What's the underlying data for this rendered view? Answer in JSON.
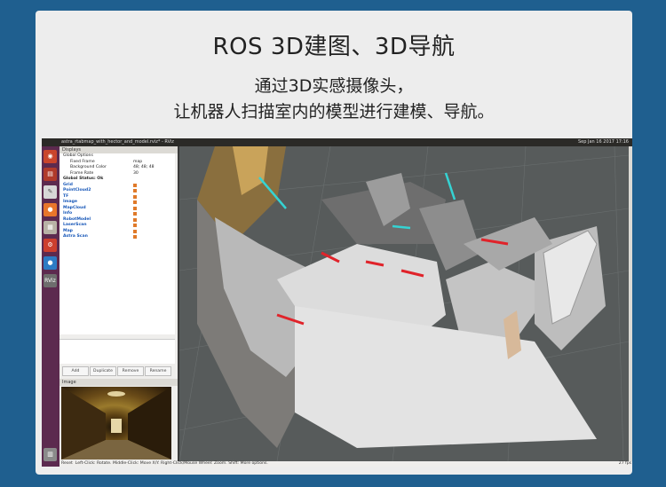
{
  "header": {
    "title": "ROS 3D建图、3D导航",
    "line1": "通过3D实感摄像头，",
    "line2": "让机器人扫描室内的模型进行建模、导航。"
  },
  "window": {
    "title": "astra_rtabmap_with_hector_and_model.rviz* - RViz",
    "clock": "Sep Jan 16 2017 17:16"
  },
  "displays": {
    "panel_title": "Displays",
    "rows": [
      {
        "key": "Global Options",
        "value": "",
        "style": "normal",
        "check": false
      },
      {
        "key": "Fixed Frame",
        "value": "map",
        "style": "normal",
        "check": false
      },
      {
        "key": "Background Color",
        "value": "48; 48; 48",
        "style": "normal",
        "check": false
      },
      {
        "key": "Frame Rate",
        "value": "30",
        "style": "normal",
        "check": false
      },
      {
        "key": "Global Status: Ok",
        "value": "",
        "style": "bold",
        "check": false
      },
      {
        "key": "Grid",
        "value": "",
        "style": "blue",
        "check": true
      },
      {
        "key": "PointCloud2",
        "value": "",
        "style": "blue",
        "check": true
      },
      {
        "key": "TF",
        "value": "",
        "style": "blue",
        "check": true
      },
      {
        "key": "Image",
        "value": "",
        "style": "blue",
        "check": true
      },
      {
        "key": "MapCloud",
        "value": "",
        "style": "blue",
        "check": true
      },
      {
        "key": "Info",
        "value": "",
        "style": "blue",
        "check": true
      },
      {
        "key": "RobotModel",
        "value": "",
        "style": "blue",
        "check": true
      },
      {
        "key": "LaserScan",
        "value": "",
        "style": "blue",
        "check": true
      },
      {
        "key": "Map",
        "value": "",
        "style": "blue",
        "check": true
      },
      {
        "key": "Astra Scan",
        "value": "",
        "style": "blue",
        "check": true
      }
    ],
    "buttons": {
      "add": "Add",
      "duplicate": "Duplicate",
      "remove": "Remove",
      "rename": "Rename"
    },
    "image_panel_title": "Image"
  },
  "status": {
    "reset": "Reset",
    "hint": "Left-Click: Rotate. Middle-Click: Move X/Y. Right-Click/Mouse Wheel: Zoom. Shift: More options.",
    "fps": "27 fps"
  },
  "launcher_icons": [
    "ubuntu-icon",
    "terminal-icon",
    "text-editor-icon",
    "firefox-icon",
    "files-icon",
    "settings-icon",
    "software-icon",
    "rviz-icon",
    "trash-icon"
  ],
  "colors": {
    "background": "#1f5f8f",
    "launcher": "#5c2a4f",
    "viewport": "#575b5b"
  }
}
